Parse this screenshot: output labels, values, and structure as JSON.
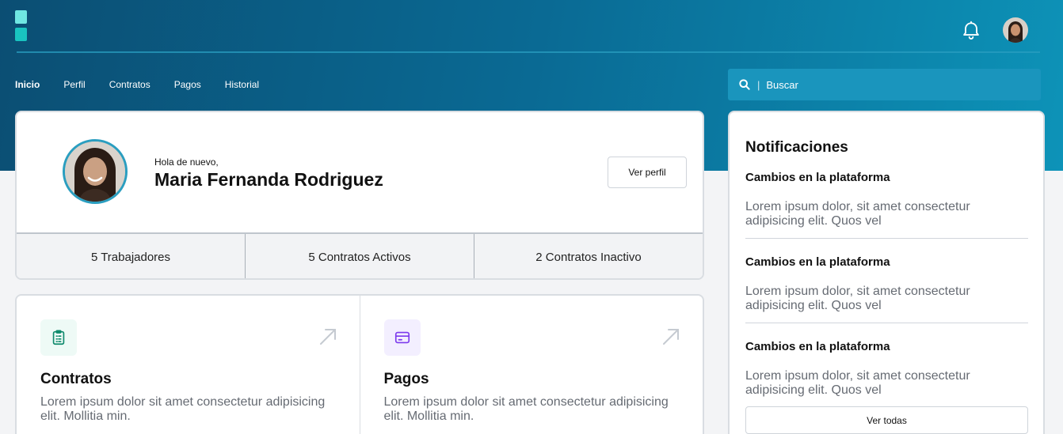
{
  "nav": {
    "items": [
      {
        "label": "Inicio",
        "active": true
      },
      {
        "label": "Perfil"
      },
      {
        "label": "Contratos"
      },
      {
        "label": "Pagos"
      },
      {
        "label": "Historial"
      }
    ]
  },
  "search": {
    "placeholder": "Buscar"
  },
  "profile": {
    "greeting": "Hola de nuevo,",
    "name": "Maria Fernanda Rodriguez",
    "button_label": "Ver perfil",
    "stats": [
      {
        "label": "5 Trabajadores"
      },
      {
        "label": "5 Contratos Activos"
      },
      {
        "label": "2 Contratos Inactivo"
      }
    ]
  },
  "cards": [
    {
      "title": "Contratos",
      "description": "Lorem ipsum dolor sit amet consectetur adipisicing elit. Mollitia min.",
      "icon": "clipboard-icon",
      "accent": "#0f8a6c",
      "icon_bg": "#eefaf6"
    },
    {
      "title": "Pagos",
      "description": "Lorem ipsum dolor sit amet consectetur adipisicing elit. Mollitia min.",
      "icon": "credit-card-icon",
      "accent": "#7c3aed",
      "icon_bg": "#f3efff"
    }
  ],
  "notifications": {
    "title": "Notificaciones",
    "items": [
      {
        "title": "Cambios en la plataforma",
        "text": "Lorem ipsum dolor, sit amet consectetur adipisicing elit. Quos vel"
      },
      {
        "title": "Cambios en la plataforma",
        "text": "Lorem ipsum dolor, sit amet consectetur adipisicing elit. Quos vel"
      },
      {
        "title": "Cambios en la plataforma",
        "text": "Lorem ipsum dolor, sit amet consectetur adipisicing elit. Quos vel"
      }
    ],
    "button_label": "Ver todas"
  },
  "colors": {
    "header_start": "#0b4e73",
    "header_end": "#0d93b8",
    "logo_light": "#6fe7e2",
    "logo_dark": "#19c4c0"
  }
}
